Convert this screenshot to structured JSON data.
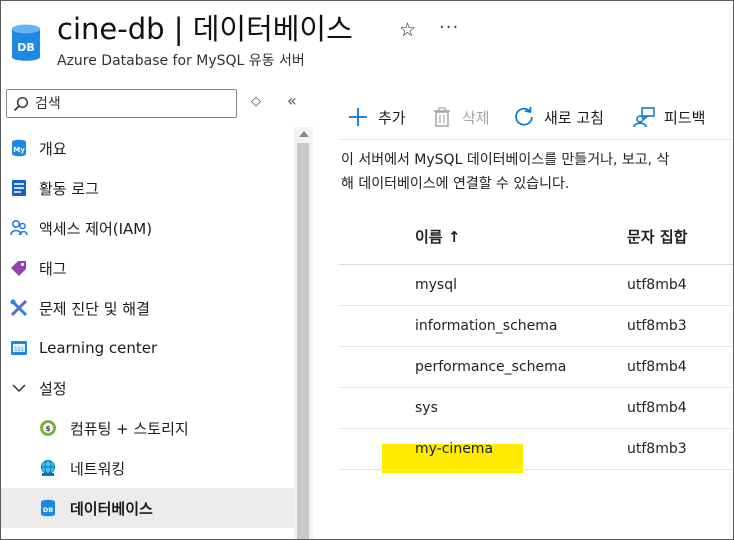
{
  "header": {
    "title": "cine-db | 데이터베이스",
    "subtitle": "Azure Database for MySQL 유동 서버",
    "db_badge": "DB",
    "star": "☆",
    "more": "···"
  },
  "sidebar": {
    "search_placeholder": "검색",
    "updown": "◇",
    "collapse": "«",
    "items": [
      {
        "label": "개요",
        "icon": "mysql-icon"
      },
      {
        "label": "활동 로그",
        "icon": "activity-log-icon"
      },
      {
        "label": "액세스 제어(IAM)",
        "icon": "people-icon"
      },
      {
        "label": "태그",
        "icon": "tag-icon"
      },
      {
        "label": "문제 진단 및 해결",
        "icon": "wrench-icon"
      },
      {
        "label": "Learning center",
        "icon": "learning-icon"
      },
      {
        "label": "설정",
        "icon": "chevron-down-icon"
      },
      {
        "label": "컴퓨팅 + 스토리지",
        "icon": "compute-icon"
      },
      {
        "label": "네트워킹",
        "icon": "network-icon"
      },
      {
        "label": "데이터베이스",
        "icon": "database-icon"
      }
    ]
  },
  "toolbar": {
    "add": "추가",
    "delete": "삭제",
    "refresh": "새로 고침",
    "feedback": "피드백"
  },
  "description": {
    "line1": "이 서버에서 MySQL 데이터베이스를 만들거나, 보고, 삭",
    "line2": "해 데이터베이스에 연결할 수 있습니다."
  },
  "table": {
    "headers": {
      "name": "이름 ↑",
      "charset": "문자 집합"
    },
    "rows": [
      {
        "name": "mysql",
        "charset": "utf8mb4"
      },
      {
        "name": "information_schema",
        "charset": "utf8mb3"
      },
      {
        "name": "performance_schema",
        "charset": "utf8mb4"
      },
      {
        "name": "sys",
        "charset": "utf8mb4"
      },
      {
        "name": "my-cinema",
        "charset": "utf8mb3"
      }
    ]
  },
  "colors": {
    "accent": "#0078d4",
    "highlight": "#ffeb00",
    "disabled": "#a6a6a6"
  }
}
